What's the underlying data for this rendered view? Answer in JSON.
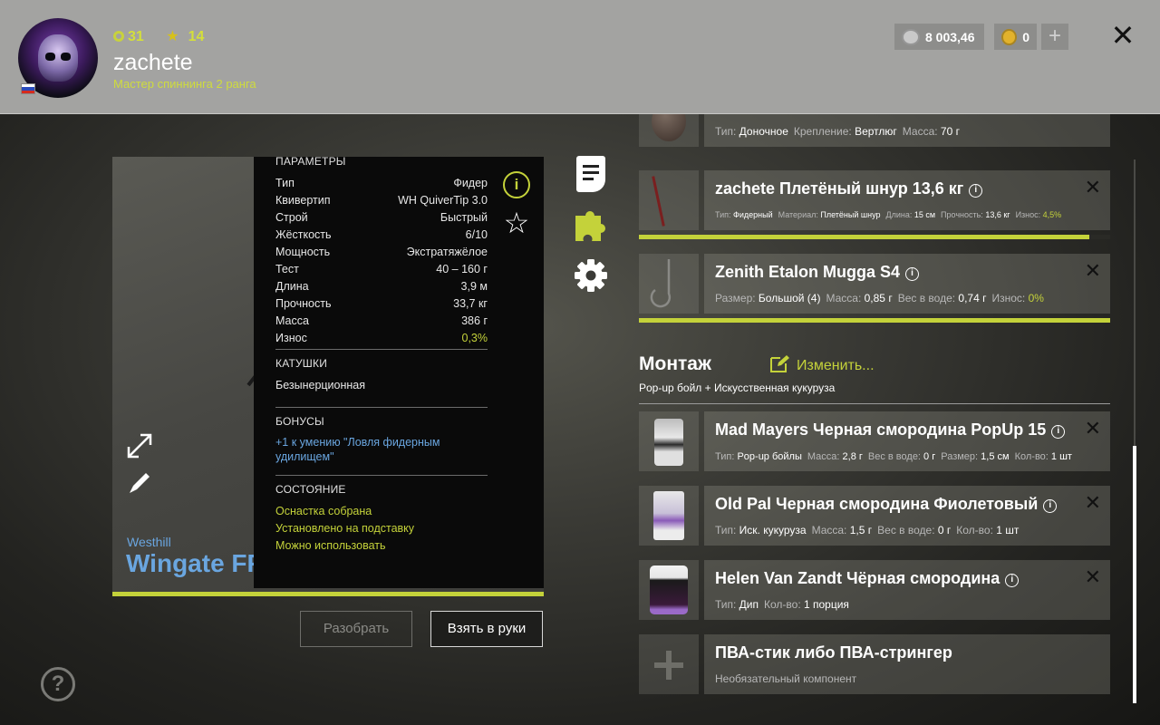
{
  "header": {
    "level": "31",
    "stars": "14",
    "username": "zachete",
    "rank": "Мастер спиннинга 2 ранга",
    "silver": "8 003,46",
    "gold": "0",
    "add_label": "+",
    "close_label": "✕"
  },
  "rod": {
    "brand": "Westhill",
    "name": "Wingate FF",
    "params_title": "ПАРАМЕТРЫ",
    "params": [
      {
        "k": "Тип",
        "v": "Фидер"
      },
      {
        "k": "Квивертип",
        "v": "WH QuiverTip 3.0"
      },
      {
        "k": "Строй",
        "v": "Быстрый"
      },
      {
        "k": "Жёсткость",
        "v": "6/10"
      },
      {
        "k": "Мощность",
        "v": "Экстратяжёлое"
      },
      {
        "k": "Тест",
        "v": "40 – 160 г"
      },
      {
        "k": "Длина",
        "v": "3,9 м"
      },
      {
        "k": "Прочность",
        "v": "33,7 кг"
      },
      {
        "k": "Масса",
        "v": "386 г"
      },
      {
        "k": "Износ",
        "v": "0,3%"
      }
    ],
    "reels_title": "КАТУШКИ",
    "reels_value": "Безынерционная",
    "bonus_title": "БОНУСЫ",
    "bonus_value": "+1 к умению \"Ловля фидерным удилищем\"",
    "state_title": "СОСТОЯНИЕ",
    "states": [
      "Оснастка собрана",
      "Установлено на подставку",
      "Можно использовать"
    ],
    "btn_disassemble": "Разобрать",
    "btn_take": "Взять в руки"
  },
  "items": {
    "sinker": {
      "props": [
        {
          "k": "Тип:",
          "v": "Доночное"
        },
        {
          "k": "Крепление:",
          "v": "Вертлюг"
        },
        {
          "k": "Масса:",
          "v": "70 г"
        }
      ]
    },
    "line": {
      "title": "zachete Плетёный шнур 13,6 кг",
      "props": [
        {
          "k": "Тип:",
          "v": "Фидерный"
        },
        {
          "k": "Материал:",
          "v": "Плетёный шнур"
        },
        {
          "k": "Длина:",
          "v": "15 см"
        },
        {
          "k": "Прочность:",
          "v": "13,6 кг"
        },
        {
          "k": "Износ:",
          "v": "4,5%"
        }
      ],
      "progress": 0.955
    },
    "hook": {
      "title": "Zenith Etalon Mugga S4",
      "props": [
        {
          "k": "Размер:",
          "v": "Большой (4)"
        },
        {
          "k": "Масса:",
          "v": "0,85 г"
        },
        {
          "k": "Вес в воде:",
          "v": "0,74 г"
        },
        {
          "k": "Износ:",
          "v": "0%"
        }
      ],
      "progress": 1.0
    },
    "montage": {
      "title": "Монтаж",
      "edit_label": "Изменить...",
      "subtitle": "Pop-up бойл  +  Искусственная кукуруза"
    },
    "bait1": {
      "title": "Mad Mayers Черная смородина PopUp 15",
      "props": [
        {
          "k": "Тип:",
          "v": "Pop-up бойлы"
        },
        {
          "k": "Масса:",
          "v": "2,8 г"
        },
        {
          "k": "Вес в воде:",
          "v": "0 г"
        },
        {
          "k": "Размер:",
          "v": "1,5 см"
        },
        {
          "k": "Кол-во:",
          "v": "1 шт"
        }
      ]
    },
    "bait2": {
      "title": "Old Pal Черная смородина Фиолетовый",
      "props": [
        {
          "k": "Тип:",
          "v": "Иск. кукуруза"
        },
        {
          "k": "Масса:",
          "v": "1,5 г"
        },
        {
          "k": "Вес в воде:",
          "v": "0 г"
        },
        {
          "k": "Кол-во:",
          "v": "1 шт"
        }
      ]
    },
    "dip": {
      "title": "Helen Van Zandt Чёрная смородина",
      "props": [
        {
          "k": "Тип:",
          "v": "Дип"
        },
        {
          "k": "Кол-во:",
          "v": "1 порция"
        }
      ]
    },
    "pva": {
      "title": "ПВА-стик либо ПВА-стрингер",
      "subtitle": "Необязательный компонент"
    }
  },
  "help_label": "?",
  "colors": {
    "accent": "#c4d23a",
    "link": "#6aa6e0"
  }
}
